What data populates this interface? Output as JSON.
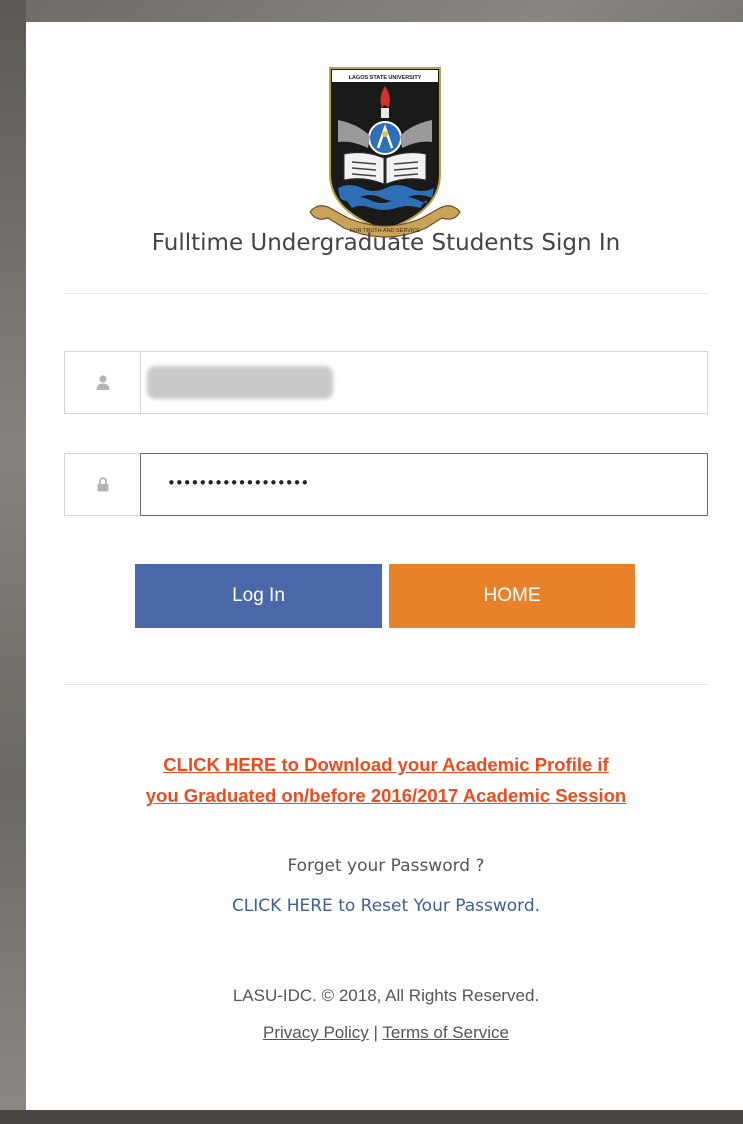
{
  "logo": {
    "banner_text": "LAGOS STATE UNIVERSITY",
    "motto": "FOR TRUTH AND SERVICE"
  },
  "form": {
    "title": "Fulltime Undergraduate Students Sign In",
    "username": {
      "icon": "user-icon",
      "value": "",
      "value_state": "blurred"
    },
    "password": {
      "icon": "lock-icon",
      "value_masked": "••••••••••••••••••"
    },
    "buttons": {
      "login_label": "Log In",
      "home_label": "HOME"
    }
  },
  "links": {
    "download_line1": "CLICK HERE to Download your Academic Profile if",
    "download_line2": "you Graduated on/before 2016/2017 Academic Session",
    "forget_text": "Forget your Password ?",
    "reset_label": "CLICK HERE to Reset Your Password."
  },
  "footer": {
    "copyright": "LASU-IDC. © 2018, All Rights Reserved.",
    "privacy_label": "Privacy Policy",
    "separator": "|",
    "terms_label": "Terms of Service"
  },
  "colors": {
    "login_button": "#4a67a8",
    "home_button": "#e8822a",
    "download_link": "#ec4b1f",
    "reset_link": "#3f5e98"
  }
}
